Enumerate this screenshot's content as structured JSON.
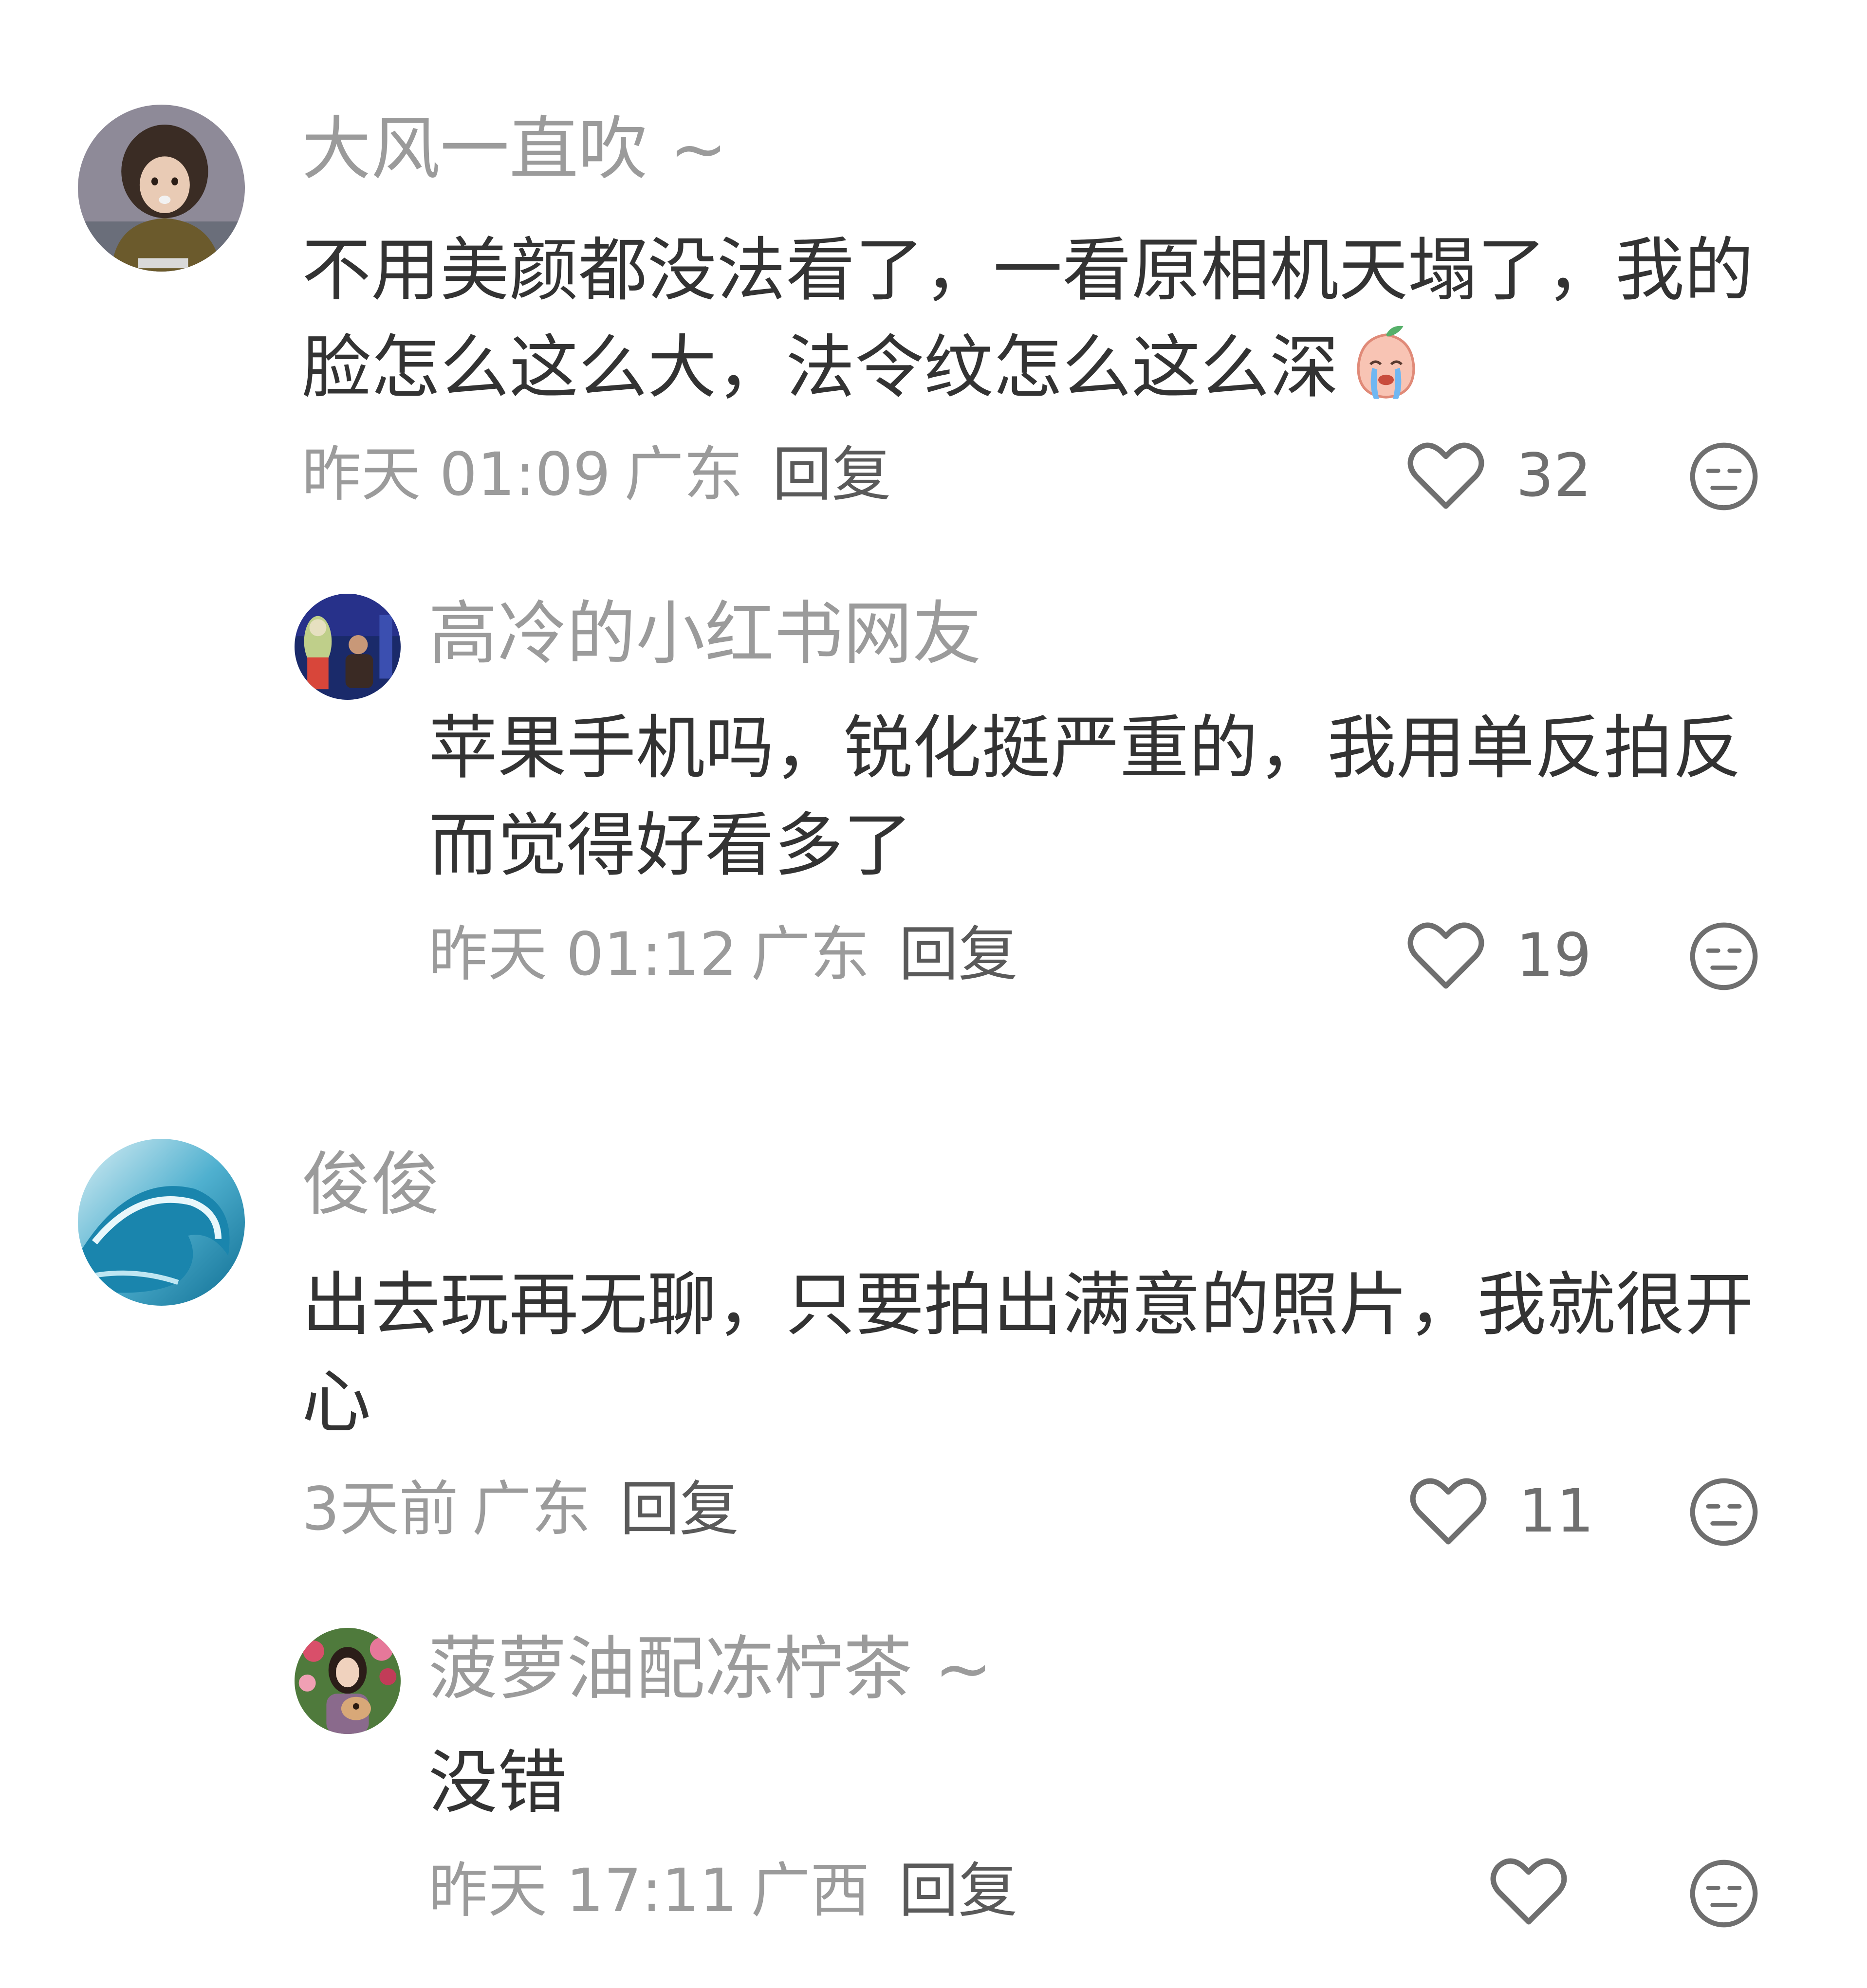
{
  "comments": [
    {
      "user": "大风一直吹 ~",
      "avatar": "toddler-photo-avatar",
      "text": "不用美颜都没法看了，一看原相机天塌了，我的脸怎么这么大，法令纹怎么这么深",
      "emoji": "crying-peach-emoji",
      "time": "昨天 01:09",
      "location": "广东",
      "reply_label": "回复",
      "likes": "32",
      "replies": [
        {
          "user": "高冷的小红书网友",
          "avatar": "night-scene-photo-avatar",
          "text": "苹果手机吗，锐化挺严重的，我用单反拍反而觉得好看多了",
          "time": "昨天 01:12",
          "location": "广东",
          "reply_label": "回复",
          "likes": "19"
        }
      ]
    },
    {
      "user": "俊俊",
      "avatar": "ocean-wave-avatar",
      "text": "出去玩再无聊，只要拍出满意的照片，我就很开心",
      "time": "3天前",
      "location": "广东",
      "reply_label": "回复",
      "likes": "11",
      "replies": [
        {
          "user": "菠萝油配冻柠茶 ~",
          "avatar": "woman-with-dog-photo-avatar",
          "text": "没错",
          "time": "昨天 17:11",
          "location": "广西",
          "reply_label": "回复",
          "likes": ""
        }
      ]
    }
  ],
  "colors": {
    "username": "#9b9b9b",
    "text": "#333333",
    "meta": "#9b9b9b",
    "icon": "#6f6f6f"
  },
  "icons": {
    "like": "heart-outline-icon",
    "dislike": "neutral-face-icon"
  }
}
